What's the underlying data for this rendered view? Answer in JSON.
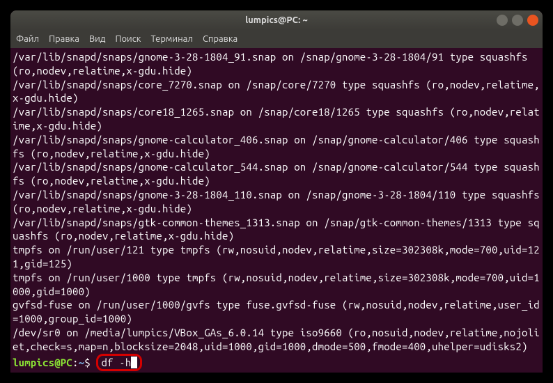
{
  "titlebar": {
    "title": "lumpics@PC: ~"
  },
  "menubar": {
    "items": [
      {
        "label": "Файл"
      },
      {
        "label": "Правка"
      },
      {
        "label": "Вид"
      },
      {
        "label": "Поиск"
      },
      {
        "label": "Терминал"
      },
      {
        "label": "Справка"
      }
    ]
  },
  "output": {
    "lines": [
      "/var/lib/snapd/snaps/gnome-3-28-1804_91.snap on /snap/gnome-3-28-1804/91 type squashfs (ro,nodev,relatime,x-gdu.hide)",
      "/var/lib/snapd/snaps/core_7270.snap on /snap/core/7270 type squashfs (ro,nodev,relatime,x-gdu.hide)",
      "/var/lib/snapd/snaps/core18_1265.snap on /snap/core18/1265 type squashfs (ro,nodev,relatime,x-gdu.hide)",
      "/var/lib/snapd/snaps/gnome-calculator_406.snap on /snap/gnome-calculator/406 type squashfs (ro,nodev,relatime,x-gdu.hide)",
      "/var/lib/snapd/snaps/gnome-calculator_544.snap on /snap/gnome-calculator/544 type squashfs (ro,nodev,relatime,x-gdu.hide)",
      "/var/lib/snapd/snaps/gnome-3-28-1804_110.snap on /snap/gnome-3-28-1804/110 type squashfs (ro,nodev,relatime,x-gdu.hide)",
      "/var/lib/snapd/snaps/gtk-common-themes_1313.snap on /snap/gtk-common-themes/1313 type squashfs (ro,nodev,relatime,x-gdu.hide)",
      "tmpfs on /run/user/121 type tmpfs (rw,nosuid,nodev,relatime,size=302308k,mode=700,uid=121,gid=125)",
      "tmpfs on /run/user/1000 type tmpfs (rw,nosuid,nodev,relatime,size=302308k,mode=700,uid=1000,gid=1000)",
      "gvfsd-fuse on /run/user/1000/gvfs type fuse.gvfsd-fuse (rw,nosuid,nodev,relatime,user_id=1000,group_id=1000)",
      "/dev/sr0 on /media/lumpics/VBox_GAs_6.0.14 type iso9660 (ro,nosuid,nodev,relatime,nojoliet,check=s,map=n,blocksize=2048,uid=1000,gid=1000,dmode=500,fmode=400,uhelper=udisks2)"
    ]
  },
  "prompt": {
    "user_host": "lumpics@PC",
    "separator": ":",
    "path": "~",
    "dollar": "$ ",
    "command": "df -h"
  }
}
